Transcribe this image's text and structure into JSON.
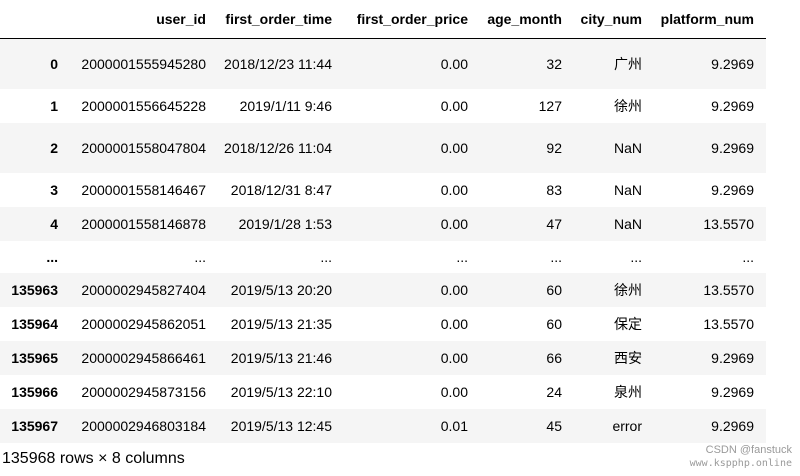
{
  "columns": {
    "index": "",
    "user_id": "user_id",
    "first_order_time": "first_order_time",
    "first_order_price": "first_order_price",
    "age_month": "age_month",
    "city_num": "city_num",
    "platform_num": "platform_num"
  },
  "rows": [
    {
      "index": "0",
      "user_id": "2000001555945280",
      "first_order_time": "2018/12/23 11:44",
      "first_order_price": "0.00",
      "age_month": "32",
      "city_num": "广州",
      "platform_num": "9.2969"
    },
    {
      "index": "1",
      "user_id": "2000001556645228",
      "first_order_time": "2019/1/11 9:46",
      "first_order_price": "0.00",
      "age_month": "127",
      "city_num": "徐州",
      "platform_num": "9.2969"
    },
    {
      "index": "2",
      "user_id": "2000001558047804",
      "first_order_time": "2018/12/26 11:04",
      "first_order_price": "0.00",
      "age_month": "92",
      "city_num": "NaN",
      "platform_num": "9.2969"
    },
    {
      "index": "3",
      "user_id": "2000001558146467",
      "first_order_time": "2018/12/31 8:47",
      "first_order_price": "0.00",
      "age_month": "83",
      "city_num": "NaN",
      "platform_num": "9.2969"
    },
    {
      "index": "4",
      "user_id": "2000001558146878",
      "first_order_time": "2019/1/28 1:53",
      "first_order_price": "0.00",
      "age_month": "47",
      "city_num": "NaN",
      "platform_num": "13.5570"
    },
    {
      "index": "...",
      "user_id": "...",
      "first_order_time": "...",
      "first_order_price": "...",
      "age_month": "...",
      "city_num": "...",
      "platform_num": "..."
    },
    {
      "index": "135963",
      "user_id": "2000002945827404",
      "first_order_time": "2019/5/13 20:20",
      "first_order_price": "0.00",
      "age_month": "60",
      "city_num": "徐州",
      "platform_num": "13.5570"
    },
    {
      "index": "135964",
      "user_id": "2000002945862051",
      "first_order_time": "2019/5/13 21:35",
      "first_order_price": "0.00",
      "age_month": "60",
      "city_num": "保定",
      "platform_num": "13.5570"
    },
    {
      "index": "135965",
      "user_id": "2000002945866461",
      "first_order_time": "2019/5/13 21:46",
      "first_order_price": "0.00",
      "age_month": "66",
      "city_num": "西安",
      "platform_num": "9.2969"
    },
    {
      "index": "135966",
      "user_id": "2000002945873156",
      "first_order_time": "2019/5/13 22:10",
      "first_order_price": "0.00",
      "age_month": "24",
      "city_num": "泉州",
      "platform_num": "9.2969"
    },
    {
      "index": "135967",
      "user_id": "2000002946803184",
      "first_order_time": "2019/5/13 12:45",
      "first_order_price": "0.01",
      "age_month": "45",
      "city_num": "error",
      "platform_num": "9.2969"
    }
  ],
  "footer": "135968 rows × 8 columns",
  "watermark": {
    "line1": "CSDN @fanstuck",
    "line2": "www.kspphp.online"
  }
}
